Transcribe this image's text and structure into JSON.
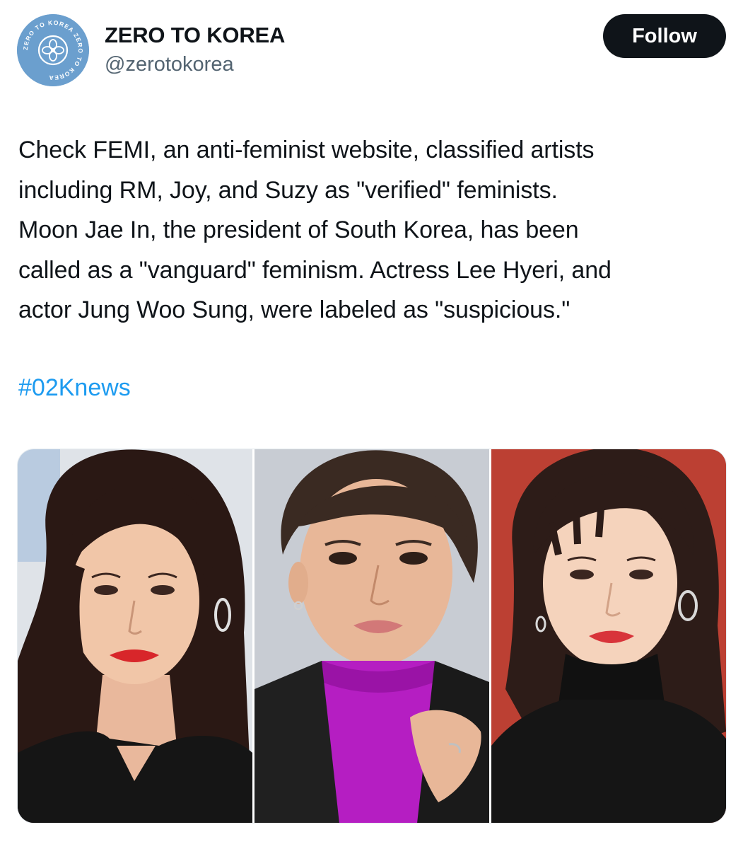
{
  "account": {
    "display_name": "ZERO TO KOREA",
    "handle": "@zerotokorea",
    "avatar_ring_text": "ZERO TO KOREA ZERO TO KOREA"
  },
  "follow_button": {
    "label": "Follow"
  },
  "tweet": {
    "lines": [
      "Check FEMI, an anti-feminist website, classified artists",
      "including RM, Joy, and Suzy as \"verified\" feminists.",
      "Moon Jae In, the president of South Korea, has been",
      "called as a \"vanguard\" feminism. Actress Lee Hyeri, and",
      "actor Jung Woo Sung, were labeled as \"suspicious.\""
    ],
    "hashtag": "#02Knews"
  },
  "media": {
    "photos": [
      {
        "subject": "woman-dark-hair-black-top",
        "background": "#d8dde3"
      },
      {
        "subject": "man-magenta-turtleneck-black-jacket",
        "background": "#c9ccd2"
      },
      {
        "subject": "woman-black-turtleneck-red-backdrop",
        "background": "#b83a2e"
      }
    ]
  },
  "colors": {
    "text_primary": "#0f1419",
    "text_secondary": "#536471",
    "link": "#1d9bf0",
    "button_bg": "#0f1419",
    "avatar_bg": "#6b9fce"
  }
}
